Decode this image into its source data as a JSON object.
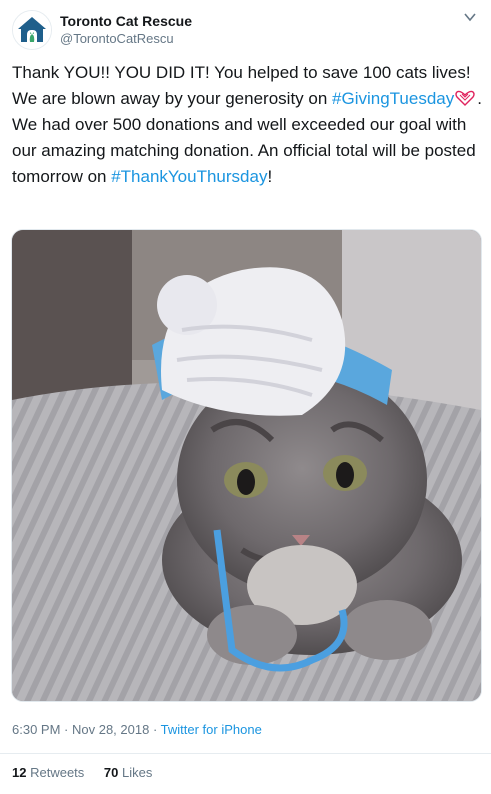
{
  "account": {
    "display_name": "Toronto Cat Rescue",
    "handle": "@TorontoCatRescu"
  },
  "tweet": {
    "part1": "Thank YOU!! YOU DID IT! You helped to save 100 cats lives! We are blown away by your generosity on ",
    "hashtag1": "#GivingTuesday",
    "part2": ". We had over 500 donations and well exceeded our goal with our amazing matching donation. An official total will be posted tomorrow on ",
    "hashtag2": "#ThankYouThursday",
    "part3": "!"
  },
  "media": {
    "icon": "kitten-in-crochet-hat-photo"
  },
  "meta": {
    "time": "6:30 PM",
    "separator1": " · ",
    "date": "Nov 28, 2018",
    "separator2": " · ",
    "source": "Twitter for iPhone"
  },
  "stats": {
    "retweets_count": "12",
    "retweets_label": "Retweets",
    "likes_count": "70",
    "likes_label": "Likes"
  },
  "colors": {
    "link": "#1b95e0",
    "logo_house": "#1f5f8b",
    "logo_cat": "#3aa66a",
    "hashtag_heart": "#e0245e"
  }
}
